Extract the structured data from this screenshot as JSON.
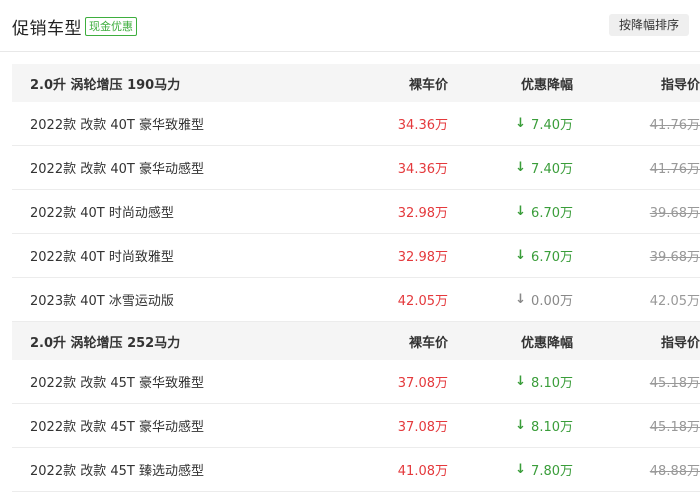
{
  "header": {
    "title": "促销车型",
    "badge": "现金优惠",
    "sort_label": "按降幅排序"
  },
  "groups": [
    {
      "engine": "2.0升 涡轮增压 190马力",
      "col_price": "裸车价",
      "col_discount": "优惠降幅",
      "col_guide": "指导价",
      "rows": [
        {
          "name": "2022款 改款 40T 豪华致雅型",
          "price": "34.36万",
          "discount": "7.40万",
          "guide": "41.76万"
        },
        {
          "name": "2022款 改款 40T 豪华动感型",
          "price": "34.36万",
          "discount": "7.40万",
          "guide": "41.76万"
        },
        {
          "name": "2022款 40T 时尚动感型",
          "price": "32.98万",
          "discount": "6.70万",
          "guide": "39.68万"
        },
        {
          "name": "2022款 40T 时尚致雅型",
          "price": "32.98万",
          "discount": "6.70万",
          "guide": "39.68万"
        },
        {
          "name": "2023款 40T 冰雪运动版",
          "price": "42.05万",
          "discount": "0.00万",
          "guide": "42.05万"
        }
      ]
    },
    {
      "engine": "2.0升 涡轮增压 252马力",
      "col_price": "裸车价",
      "col_discount": "优惠降幅",
      "col_guide": "指导价",
      "rows": [
        {
          "name": "2022款 改款 45T 豪华致雅型",
          "price": "37.08万",
          "discount": "8.10万",
          "guide": "45.18万"
        },
        {
          "name": "2022款 改款 45T 豪华动感型",
          "price": "37.08万",
          "discount": "8.10万",
          "guide": "45.18万"
        },
        {
          "name": "2022款 改款 45T 臻选动感型",
          "price": "41.08万",
          "discount": "7.80万",
          "guide": "48.88万"
        }
      ]
    }
  ],
  "icons": {
    "down_arrow": "↓"
  },
  "colors": {
    "price": "#e4393c",
    "discount": "#3a9d3a",
    "no_discount": "#888888",
    "badge": "#3eae3e"
  }
}
